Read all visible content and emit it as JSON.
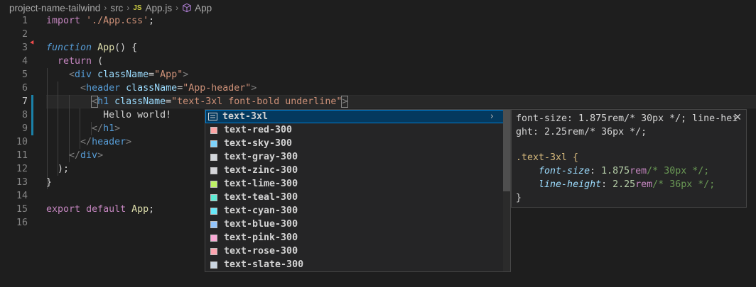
{
  "breadcrumb": {
    "project": "project-name-tailwind",
    "folder": "src",
    "file_badge": "JS",
    "file": "App.js",
    "symbol": "App"
  },
  "editor": {
    "line_numbers": [
      "1",
      "2",
      "3",
      "4",
      "5",
      "6",
      "7",
      "8",
      "9",
      "10",
      "11",
      "12",
      "13",
      "14",
      "15",
      "16"
    ],
    "tokens": {
      "l1": [
        "import",
        "'./App.css'",
        ";"
      ],
      "l3": [
        "function",
        "App",
        "() {"
      ],
      "l4": [
        "return",
        " ("
      ],
      "l5": [
        "<",
        "div",
        "className",
        "=",
        "\"App\"",
        ">"
      ],
      "l6": [
        "<",
        "header",
        "className",
        "=",
        "\"App-header\"",
        ">"
      ],
      "l7": [
        "<",
        "h1",
        "className",
        "=",
        "\"text-3xl font-bold underline\"",
        ">"
      ],
      "l8": [
        "Hello world!"
      ],
      "l9": [
        "</",
        "h1",
        ">"
      ],
      "l10": [
        "</",
        "header",
        ">"
      ],
      "l11": [
        "</",
        "div",
        ">"
      ],
      "l12": [
        ");"
      ],
      "l13": [
        "}"
      ],
      "l15": [
        "export",
        "default",
        "App",
        ";"
      ]
    }
  },
  "suggestions": [
    {
      "label": "text-3xl",
      "color": ""
    },
    {
      "label": "text-red-300",
      "color": "#fca5a5"
    },
    {
      "label": "text-sky-300",
      "color": "#7dd3fc"
    },
    {
      "label": "text-gray-300",
      "color": "#d1d5db"
    },
    {
      "label": "text-zinc-300",
      "color": "#d4d4d8"
    },
    {
      "label": "text-lime-300",
      "color": "#bef264"
    },
    {
      "label": "text-teal-300",
      "color": "#5eead4"
    },
    {
      "label": "text-cyan-300",
      "color": "#67e8f9"
    },
    {
      "label": "text-blue-300",
      "color": "#93c5fd"
    },
    {
      "label": "text-pink-300",
      "color": "#f9a8d4"
    },
    {
      "label": "text-rose-300",
      "color": "#fda4af"
    },
    {
      "label": "text-slate-300",
      "color": "#cbd5e1"
    }
  ],
  "details": {
    "doc_line1": "font-size: 1.875rem/* 30px */; line-hei",
    "doc_line2": "ght: 2.25rem/* 36px */;",
    "selector": ".text-3xl {",
    "prop1": {
      "name": "font-size",
      "num": "1.875",
      "unit": "rem",
      "comment": "/* 30px */;"
    },
    "prop2": {
      "name": "line-height",
      "num": "2.25",
      "unit": "rem",
      "comment": "/* 36px */;"
    },
    "close_brace": "}",
    "close_glyph": "✕"
  },
  "icons": {
    "chevron": "›",
    "breadcrumb_sep": "›"
  }
}
